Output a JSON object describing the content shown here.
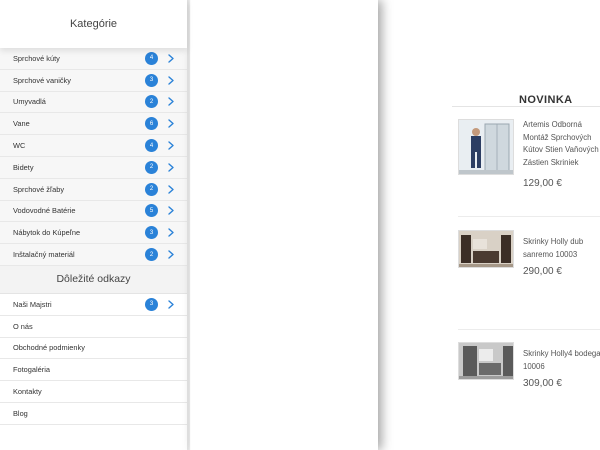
{
  "menu": {
    "title": "Kategórie",
    "categories": [
      {
        "label": "Sprchové kúty",
        "count": "4"
      },
      {
        "label": "Sprchové vaničky",
        "count": "3"
      },
      {
        "label": "Umyvadlá",
        "count": "2"
      },
      {
        "label": "Vane",
        "count": "6"
      },
      {
        "label": "WC",
        "count": "4"
      },
      {
        "label": "Bidety",
        "count": "2"
      },
      {
        "label": "Sprchové žľaby",
        "count": "2"
      },
      {
        "label": "Vodovodné Batérie",
        "count": "5"
      },
      {
        "label": "Nábytok do Kúpeľne",
        "count": "3"
      },
      {
        "label": "Inštalačný materiál",
        "count": "2"
      }
    ],
    "links_title": "Dôležité odkazy",
    "links": [
      {
        "label": "Naši Majstri",
        "count": "3"
      },
      {
        "label": "O nás"
      },
      {
        "label": "Obchodné podmienky"
      },
      {
        "label": "Fotogaléria"
      },
      {
        "label": "Kontakty"
      },
      {
        "label": "Blog"
      }
    ]
  },
  "news": {
    "title": "NOVINKA",
    "products": [
      {
        "name_lines": [
          "Artemis Odborná",
          "Montáž Sprchových",
          "Kútov Stien Vaňových",
          "Zástien Skriniek"
        ],
        "price": "129,00 €"
      },
      {
        "name_lines": [
          "Skrinky Holly dub",
          "sanremo 10003"
        ],
        "price": "290,00 €"
      },
      {
        "name_lines": [
          "Skrinky Holly4 bodega",
          "10006"
        ],
        "price": "309,00 €"
      }
    ]
  },
  "colors": {
    "badge": "#2a82d8",
    "chevron": "#2a82d8"
  }
}
